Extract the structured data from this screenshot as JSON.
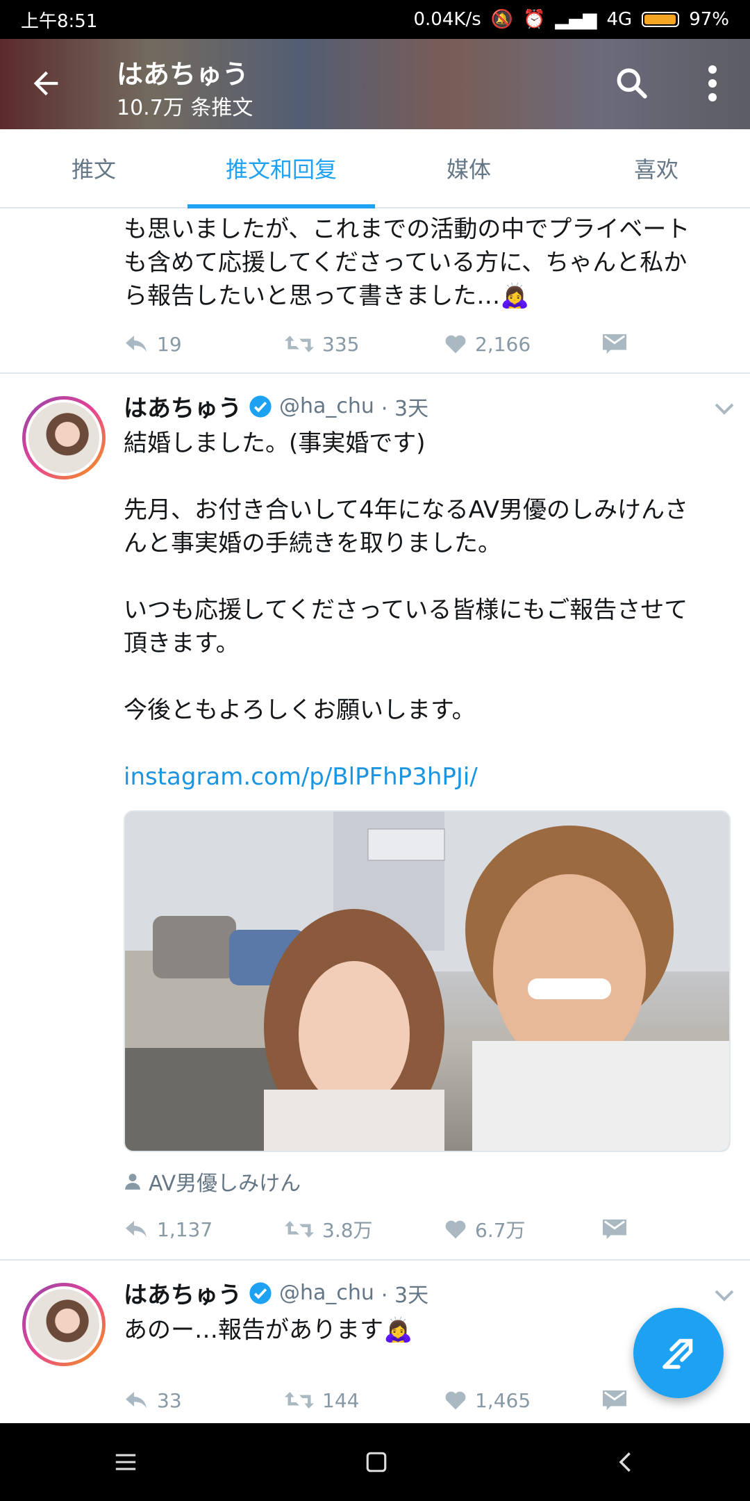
{
  "status_bar": {
    "time": "上午8:51",
    "speed": "0.04K/s",
    "network": "4G",
    "battery": "97%"
  },
  "header": {
    "name": "はあちゅう",
    "tweet_count": "10.7万 条推文"
  },
  "tabs": [
    {
      "label": "推文"
    },
    {
      "label": "推文和回复"
    },
    {
      "label": "媒体"
    },
    {
      "label": "喜欢"
    }
  ],
  "tweets": [
    {
      "text_lines": [
        "も思いましたが、これまでの活動の中でプライベート",
        "も含めて応援してくださっている方に、ちゃんと私か",
        "ら報告したいと思って書きました…🙇‍♀️"
      ],
      "reply_count": "19",
      "retweet_count": "335",
      "like_count": "2,166"
    },
    {
      "author_name": "はあちゅう",
      "handle": "@ha_chu",
      "time": "· 3天",
      "text_lines": [
        "結婚しました。(事実婚です)",
        "",
        "先月、お付き合いして4年になるAV男優のしみけんさ",
        "んと事実婚の手続きを取りました。",
        "",
        "いつも応援してくださっている皆様にもご報告させて",
        "頂きます。",
        "",
        "今後ともよろしくお願いします。"
      ],
      "link": "instagram.com/p/BlPFhP3hPJi/",
      "tagged_user": "AV男優しみけん",
      "reply_count": "1,137",
      "retweet_count": "3.8万",
      "like_count": "6.7万"
    },
    {
      "author_name": "はあちゅう",
      "handle": "@ha_chu",
      "time": "· 3天",
      "text": "あのー…報告があります🙇‍♀️",
      "reply_count": "33",
      "retweet_count": "144",
      "like_count": "1,465"
    }
  ],
  "colors": {
    "accent": "#1da1f2",
    "secondary_text": "#657786",
    "action_gray": "#8899a6"
  }
}
